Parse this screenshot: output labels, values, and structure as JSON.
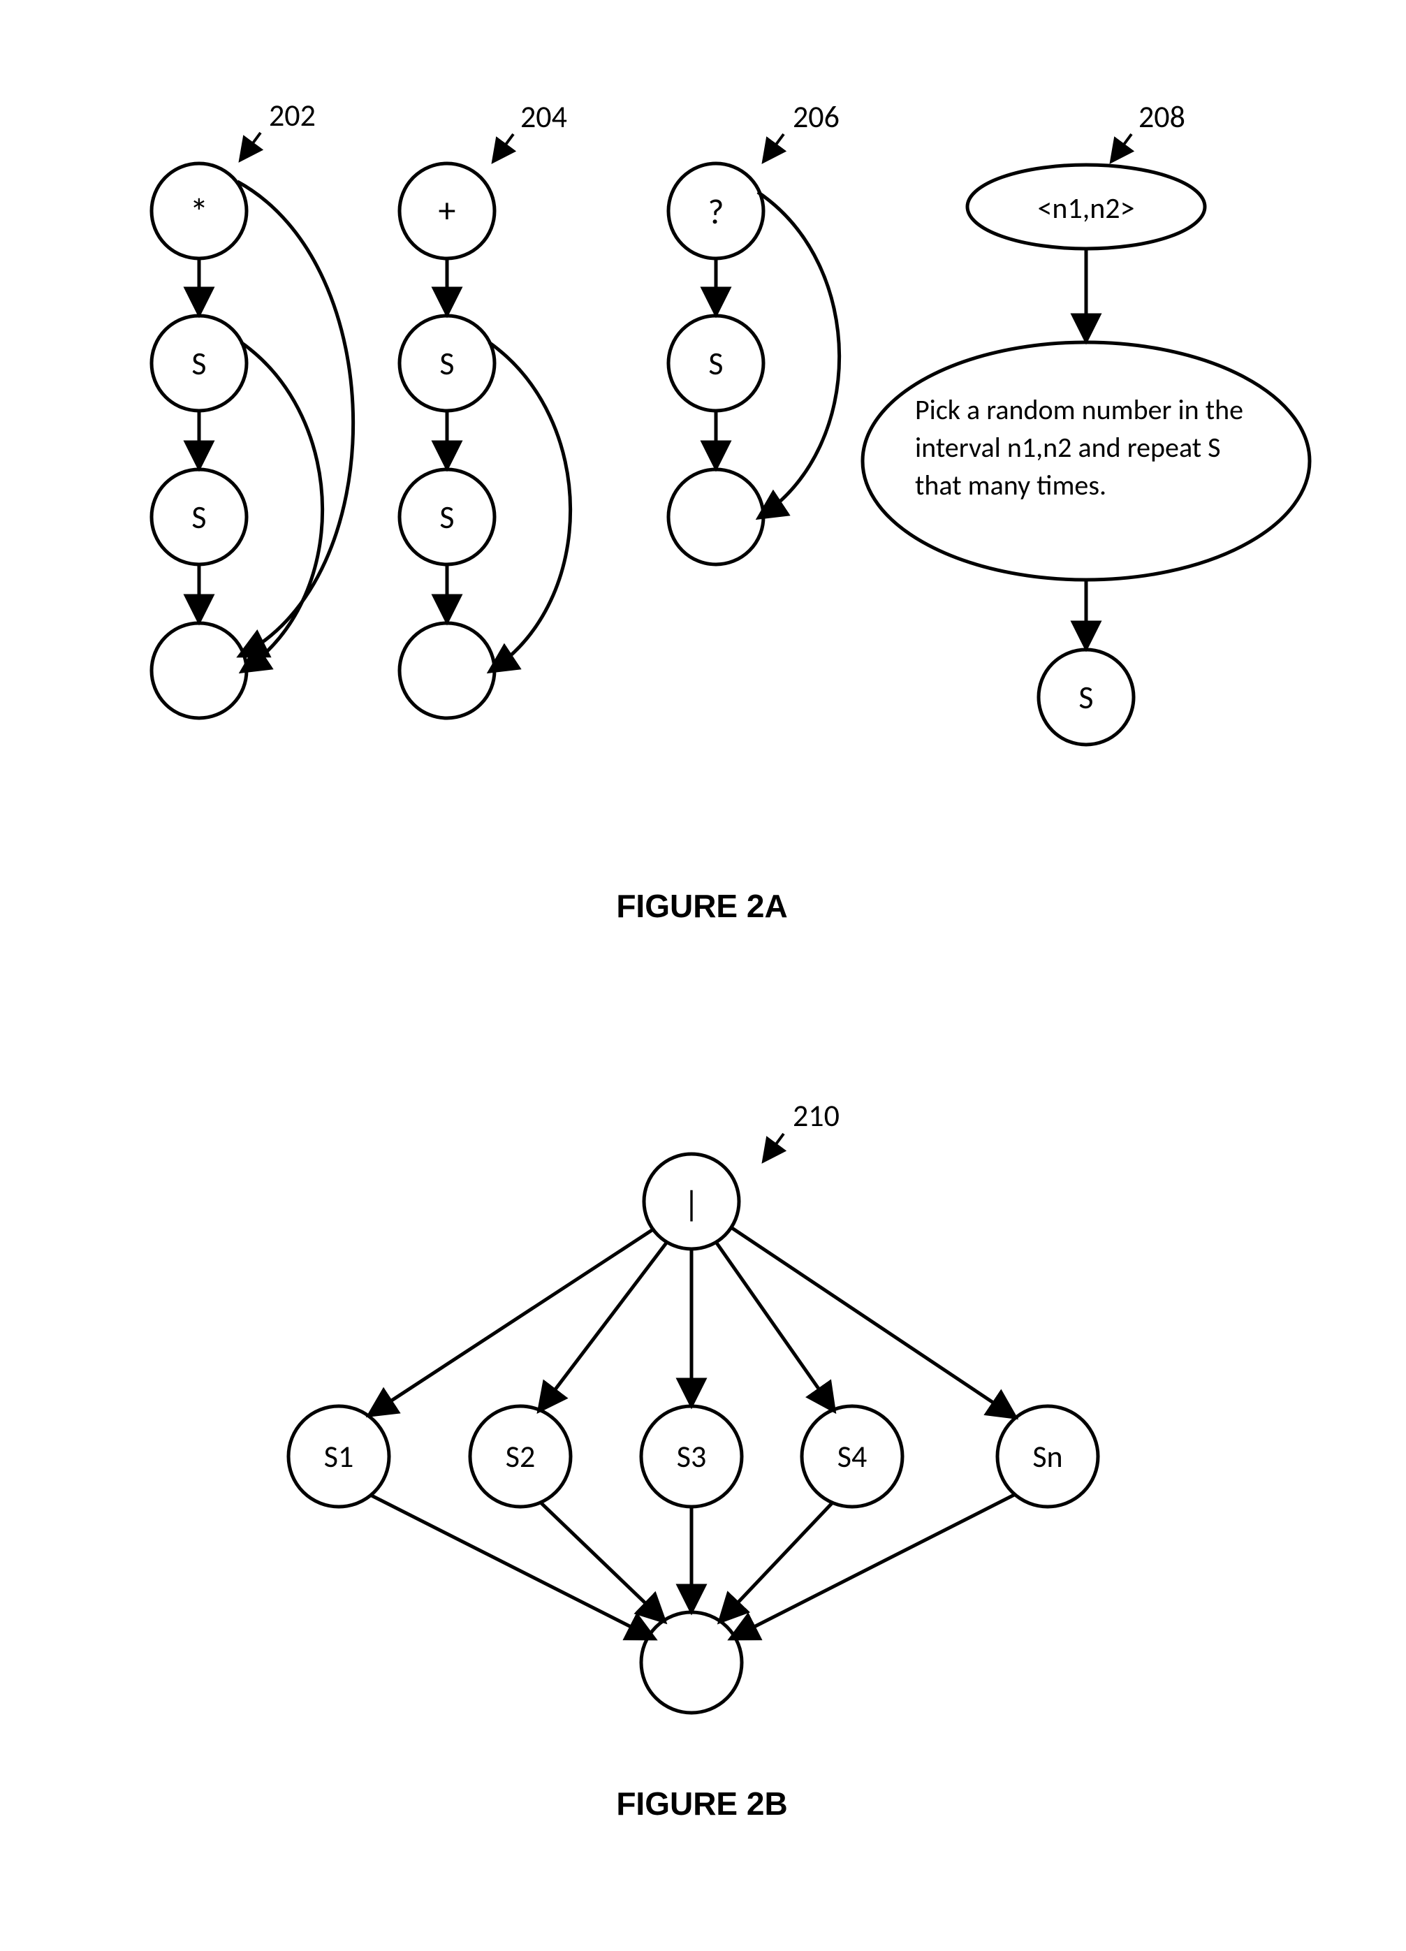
{
  "figure2a": {
    "caption": "FIGURE 2A",
    "trees": {
      "star": {
        "ref": "202",
        "nodes": [
          "*",
          "S",
          "S",
          ""
        ]
      },
      "plus": {
        "ref": "204",
        "nodes": [
          "+",
          "S",
          "S",
          ""
        ]
      },
      "question": {
        "ref": "206",
        "nodes": [
          "?",
          "S",
          ""
        ]
      },
      "range": {
        "ref": "208",
        "top": "<n1,n2>",
        "desc": "Pick a random number in the interval n1,n2 and repeat S that many times.",
        "bottom": "S"
      }
    }
  },
  "figure2b": {
    "caption": "FIGURE 2B",
    "ref": "210",
    "top": "|",
    "children": [
      "S1",
      "S2",
      "S3",
      "S4",
      "Sn"
    ],
    "bottom": ""
  }
}
